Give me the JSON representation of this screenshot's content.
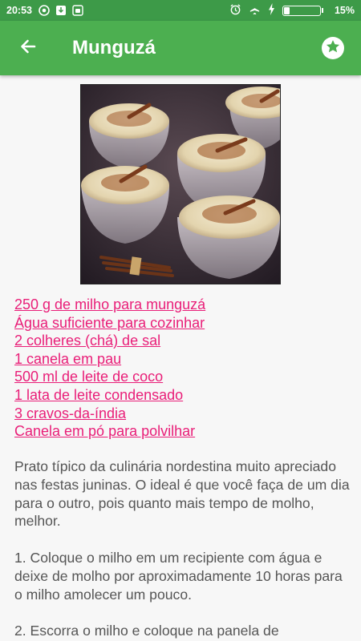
{
  "status_bar": {
    "time": "20:53",
    "battery_percent": "15%",
    "battery_level": 0.15,
    "left_icons": [
      "whatsapp-icon",
      "download-icon",
      "android-icon"
    ],
    "right_icons": [
      "alarm-icon",
      "airplane-mode-icon",
      "charging-icon",
      "battery-icon"
    ]
  },
  "app_bar": {
    "title": "Munguzá",
    "back_icon": "arrow-left-icon",
    "favorite_icon": "star-icon"
  },
  "recipe": {
    "image_alt": "munguza-dessert-photo",
    "ingredients": [
      "250 g de milho para munguzá",
      "Água suficiente para cozinhar",
      "2 colheres (chá) de sal",
      "1 canela em pau",
      "500 ml de leite de coco",
      "1 lata de leite condensado",
      "3 cravos-da-índia",
      "Canela em pó para polvilhar"
    ],
    "description": "Prato típico da culinária nordestina muito apreciado nas festas juninas. O ideal é que você faça de um dia para o outro, pois quanto mais tempo de molho, melhor.",
    "steps": [
      "1. Coloque o milho em um recipiente com água e deixe de molho por aproximadamente 10 horas para o milho amolecer um pouco.",
      "2. Escorra o milho e coloque na panela de"
    ]
  },
  "colors": {
    "status_bar": "#3d9a48",
    "app_bar": "#4caf50",
    "ingredient_link": "#e91e78",
    "body_text": "#555555",
    "background": "#f7f7f7"
  }
}
